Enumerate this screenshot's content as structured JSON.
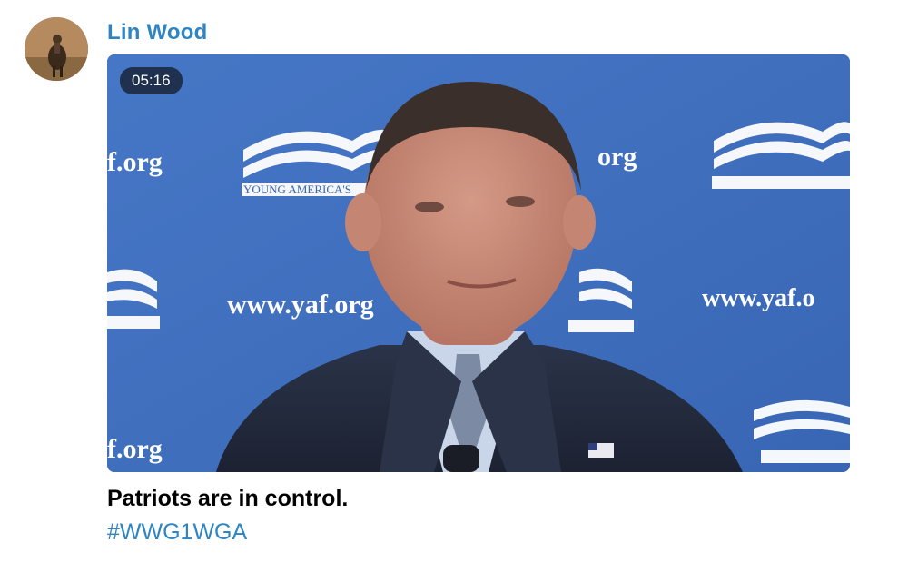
{
  "post": {
    "author": "Lin Wood",
    "caption": "Patriots are in control.",
    "hashtag": "#WWG1WGA"
  },
  "video": {
    "duration": "05:16",
    "backdrop_texts": {
      "org_top_left": "f.org",
      "org_top_mid": "org",
      "url_mid_left": "www.yaf.org",
      "url_mid_right": "www.yaf.o",
      "org_bottom_left": "f.org",
      "logo_text": "YOUNG AMERICA'S"
    }
  },
  "colors": {
    "link": "#2f85c4",
    "backdrop_blue": "#3f6fbf",
    "duration_badge": "#141e2d"
  }
}
